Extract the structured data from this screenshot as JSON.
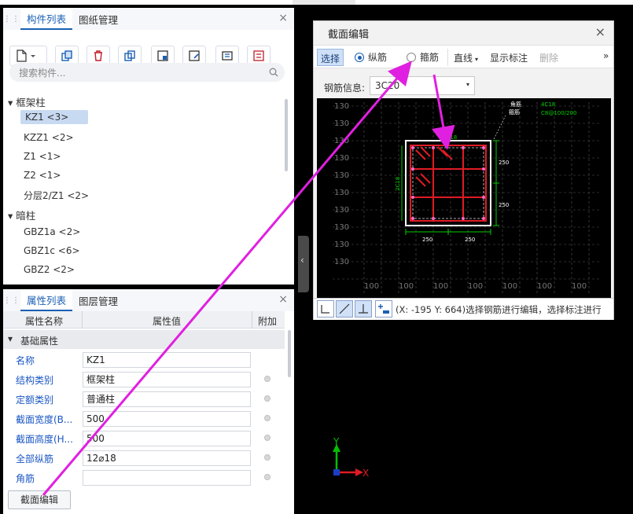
{
  "component_panel": {
    "tabs": [
      "构件列表",
      "图纸管理"
    ],
    "close": "×",
    "search_placeholder": "搜索构件...",
    "groups": [
      {
        "name": "框架柱",
        "items": [
          "KZ1 <3>",
          "KZZ1 <2>",
          "Z1 <1>",
          "Z2 <1>",
          "分层2/Z1 <2>"
        ]
      },
      {
        "name": "暗柱",
        "items": [
          "GBZ1a <2>",
          "GBZ1c <6>",
          "GBZ2 <2>"
        ]
      }
    ],
    "selected_item": "KZ1 <3>"
  },
  "property_panel": {
    "tabs": [
      "属性列表",
      "图层管理"
    ],
    "close": "×",
    "headers": [
      "属性名称",
      "属性值",
      "附加"
    ],
    "section": "基础属性",
    "rows": [
      {
        "name": "名称",
        "value": "KZ1",
        "dot": false
      },
      {
        "name": "结构类别",
        "value": "框架柱",
        "dot": true
      },
      {
        "name": "定额类别",
        "value": "普通柱",
        "dot": true
      },
      {
        "name": "截面宽度(B...",
        "value": "500",
        "dot": true
      },
      {
        "name": "截面高度(H...",
        "value": "500",
        "dot": true
      },
      {
        "name": "全部纵筋",
        "value": "12⌀18",
        "dot": true
      },
      {
        "name": "角筋",
        "value": "",
        "dot": true
      }
    ],
    "button": "截面编辑"
  },
  "dialog": {
    "title": "截面编辑",
    "close": "×",
    "toolbar": {
      "select": "选择",
      "longitudinal": "纵筋",
      "stirrup": "箍筋",
      "line": "直线",
      "show_annotation": "显示标注",
      "delete": "删除",
      "more": "»"
    },
    "rebar_info_label": "钢筋信息:",
    "rebar_info_value": "3C20",
    "status_text": "(X: -195 Y: 664)选择钢筋进行编辑，选择标注进行",
    "cad": {
      "top_labels": [
        "4C18",
        "C8@100/200"
      ],
      "legend": [
        "角筋",
        "箍筋"
      ],
      "dims": [
        "250",
        "250",
        "250",
        "250"
      ],
      "left_dim": "2C18",
      "top_dim": "2C18",
      "grid_label": "100",
      "grid_left": "130"
    }
  },
  "axis": {
    "x": "X",
    "y": "Y"
  },
  "colors": {
    "accent": "#1a5fb4",
    "annotation": "#e020e0",
    "rebar": "#e01b24",
    "dim": "#00d000"
  }
}
